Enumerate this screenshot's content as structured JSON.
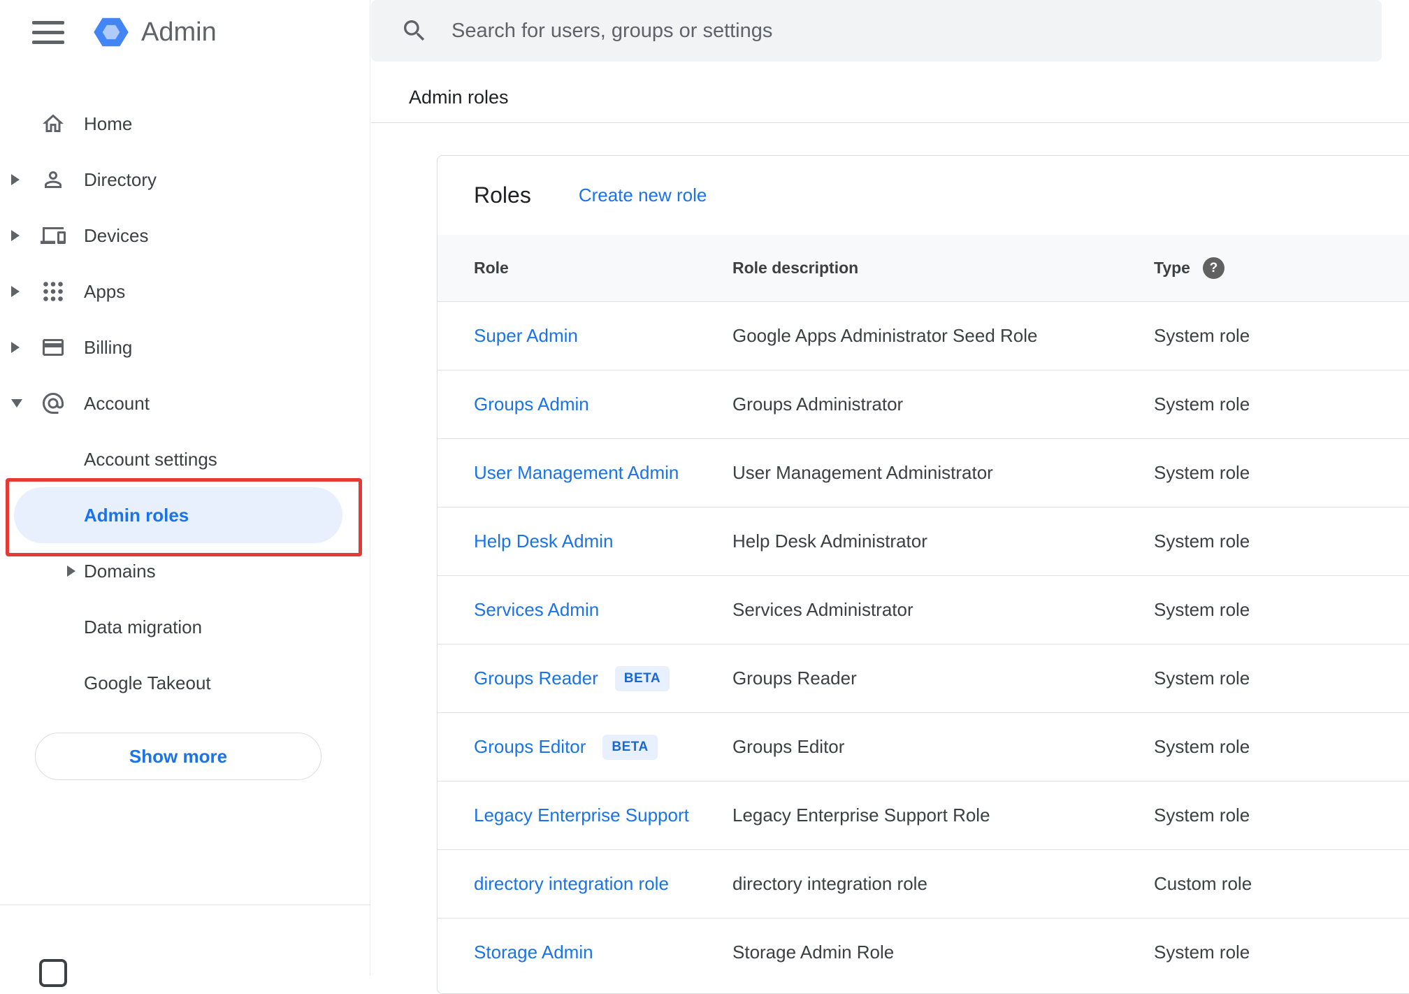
{
  "app": {
    "name": "Admin"
  },
  "search": {
    "placeholder": "Search for users, groups or settings"
  },
  "breadcrumb": {
    "label": "Admin roles"
  },
  "sidebar": {
    "items": [
      {
        "label": "Home"
      },
      {
        "label": "Directory"
      },
      {
        "label": "Devices"
      },
      {
        "label": "Apps"
      },
      {
        "label": "Billing"
      },
      {
        "label": "Account"
      }
    ],
    "account_children": [
      {
        "label": "Account settings"
      },
      {
        "label": "Admin roles"
      },
      {
        "label": "Domains"
      },
      {
        "label": "Data migration"
      },
      {
        "label": "Google Takeout"
      }
    ],
    "show_more": "Show more"
  },
  "roles_card": {
    "title": "Roles",
    "create_new": "Create new role",
    "columns": {
      "role": "Role",
      "description": "Role description",
      "type": "Type"
    },
    "rows": [
      {
        "role": "Super Admin",
        "description": "Google Apps Administrator Seed Role",
        "type": "System role"
      },
      {
        "role": "Groups Admin",
        "description": "Groups Administrator",
        "type": "System role"
      },
      {
        "role": "User Management Admin",
        "description": "User Management Administrator",
        "type": "System role"
      },
      {
        "role": "Help Desk Admin",
        "description": "Help Desk Administrator",
        "type": "System role"
      },
      {
        "role": "Services Admin",
        "description": "Services Administrator",
        "type": "System role"
      },
      {
        "role": "Groups Reader",
        "badge": "BETA",
        "description": "Groups Reader",
        "type": "System role"
      },
      {
        "role": "Groups Editor",
        "badge": "BETA",
        "description": "Groups Editor",
        "type": "System role"
      },
      {
        "role": "Legacy Enterprise Support",
        "description": "Legacy Enterprise Support Role",
        "type": "System role"
      },
      {
        "role": "directory integration role",
        "description": "directory integration role",
        "type": "Custom role"
      },
      {
        "role": "Storage Admin",
        "description": "Storage Admin Role",
        "type": "System role"
      }
    ]
  },
  "colors": {
    "link_blue": "#1a73e8",
    "selected_item_bg": "#e8f0fe",
    "selected_item_text": "#1a73e8",
    "badge_bg": "#e8f0fe",
    "badge_text": "#1967d2",
    "annotation_red": "#e53935",
    "search_bg": "#f1f3f4",
    "table_header_bg": "#f8f9fa"
  }
}
